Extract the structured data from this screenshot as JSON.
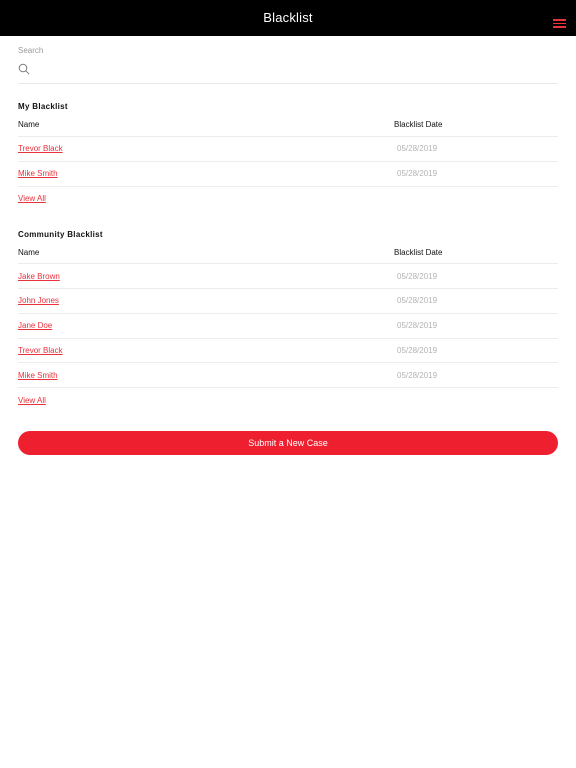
{
  "header": {
    "title": "Blacklist",
    "menu_icon": "hamburger-icon",
    "menu_color": "#e8323c"
  },
  "search": {
    "label": "Search",
    "value": "",
    "placeholder": "",
    "icon": "search-icon"
  },
  "my_blacklist": {
    "title": "My Blacklist",
    "columns": {
      "name": "Name",
      "date": "Blacklist Date"
    },
    "rows": [
      {
        "name": "Trevor Black",
        "date": "05/28/2019"
      },
      {
        "name": "Mike Smith",
        "date": "05/28/2019"
      }
    ],
    "view_all": "View All"
  },
  "community_blacklist": {
    "title": "Community Blacklist",
    "columns": {
      "name": "Name",
      "date": "Blacklist Date"
    },
    "rows": [
      {
        "name": "Jake Brown",
        "date": "05/28/2019"
      },
      {
        "name": "John Jones",
        "date": "05/28/2019"
      },
      {
        "name": "Jane Doe",
        "date": "05/28/2019"
      },
      {
        "name": "Trevor Black",
        "date": "05/28/2019"
      },
      {
        "name": "Mike Smith",
        "date": "05/28/2019"
      }
    ],
    "view_all": "View All"
  },
  "actions": {
    "submit_label": "Submit a New Case",
    "accent": "#ee1f2f"
  }
}
